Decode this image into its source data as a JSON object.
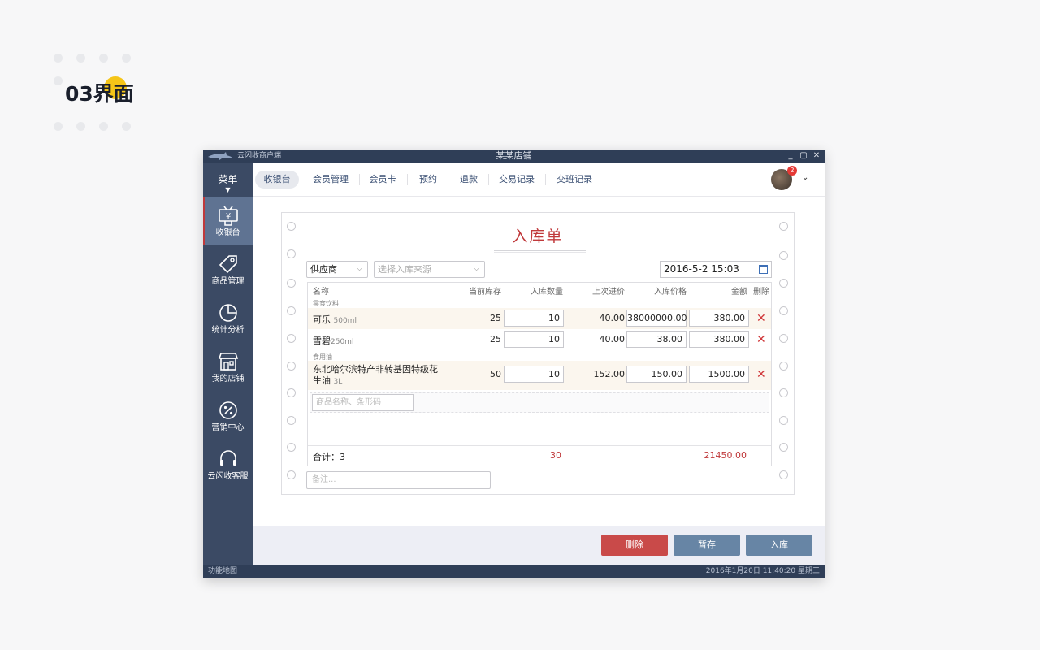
{
  "page": {
    "heading": "03界面"
  },
  "window": {
    "app_name": "云闪收商户端",
    "title": "某某店铺",
    "controls": [
      "_",
      "▢",
      "✕"
    ]
  },
  "sidebar": {
    "menu_label": "菜单",
    "items": [
      {
        "label": "收银台",
        "icon": "cashier-icon",
        "active": true
      },
      {
        "label": "商品管理",
        "icon": "tag-icon"
      },
      {
        "label": "统计分析",
        "icon": "pie-chart-icon"
      },
      {
        "label": "我的店铺",
        "icon": "store-icon"
      },
      {
        "label": "营销中心",
        "icon": "discount-icon"
      },
      {
        "label": "云闪收客服",
        "icon": "headset-icon"
      }
    ]
  },
  "topnav": {
    "tabs": [
      "收银台",
      "会员管理",
      "会员卡",
      "预约",
      "退款",
      "交易记录",
      "交班记录"
    ],
    "active_tab": 0,
    "notification_count": "2"
  },
  "form": {
    "title": "入库单",
    "supplier": "供应商",
    "source_placeholder": "选择入库来源",
    "datetime": "2016-5-2  15:03",
    "columns": [
      "名称",
      "当前库存",
      "入库数量",
      "上次进价",
      "入库价格",
      "金额",
      "删除"
    ],
    "categories": [
      "零食饮料",
      "食用油"
    ],
    "rows": [
      {
        "name": "可乐",
        "spec": "500ml",
        "stock": "25",
        "qty": "10",
        "last_price": "40.00",
        "price": "38000000.00",
        "amount": "380.00"
      },
      {
        "name": "雪碧",
        "spec": "250ml",
        "stock": "25",
        "qty": "10",
        "last_price": "40.00",
        "price": "38.00",
        "amount": "380.00"
      },
      {
        "name_line1": "东北哈尔滨特产非转基因特级花",
        "name_line2": "生油",
        "spec": "3L",
        "stock": "50",
        "qty": "10",
        "last_price": "152.00",
        "price": "150.00",
        "amount": "1500.00"
      }
    ],
    "search_placeholder": "商品名称、条形码",
    "total_label": "合计：3",
    "total_qty": "30",
    "total_amount": "21450.00",
    "note_placeholder": "备注..."
  },
  "actions": {
    "delete": "删除",
    "save_draft": "暂存",
    "stock_in": "入库"
  },
  "statusbar": {
    "left": "功能地图",
    "right": "2016年1月20日   11:40:20 星期三"
  },
  "colors": {
    "sidebar": "#3b4a64",
    "titlebar": "#2f3e57",
    "accent_red": "#c0393b",
    "button_blue": "#6785a5",
    "highlight_yellow": "#f5c518"
  }
}
